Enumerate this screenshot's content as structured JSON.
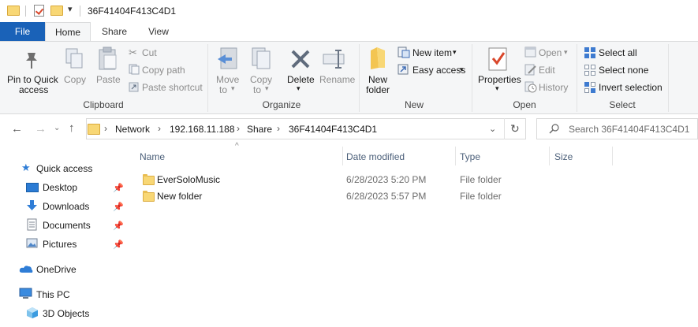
{
  "window": {
    "title": "36F41404F413C4D1"
  },
  "tabs": [
    "File",
    "Home",
    "Share",
    "View"
  ],
  "ribbon": {
    "clipboard": {
      "label": "Clipboard",
      "pin_line1": "Pin to Quick",
      "pin_line2": "access",
      "copy": "Copy",
      "paste": "Paste",
      "cut": "Cut",
      "copy_path": "Copy path",
      "paste_shortcut": "Paste shortcut"
    },
    "organize": {
      "label": "Organize",
      "move_to": "Move",
      "move_to_2": "to",
      "copy_to": "Copy",
      "copy_to_2": "to",
      "delete": "Delete",
      "rename": "Rename"
    },
    "new": {
      "label": "New",
      "new_folder_1": "New",
      "new_folder_2": "folder",
      "new_item": "New item",
      "easy_access": "Easy access"
    },
    "open": {
      "label": "Open",
      "properties": "Properties",
      "open": "Open",
      "edit": "Edit",
      "history": "History"
    },
    "select": {
      "label": "Select",
      "select_all": "Select all",
      "select_none": "Select none",
      "invert": "Invert selection"
    }
  },
  "address": {
    "crumbs": [
      "Network",
      "192.168.11.188",
      "Share",
      "36F41404F413C4D1"
    ],
    "search_placeholder": "Search 36F41404F413C4D1"
  },
  "columns": {
    "name": "Name",
    "date": "Date modified",
    "type": "Type",
    "size": "Size"
  },
  "files": [
    {
      "name": "EverSoloMusic",
      "date": "6/28/2023 5:20 PM",
      "type": "File folder",
      "size": ""
    },
    {
      "name": "New folder",
      "date": "6/28/2023 5:57 PM",
      "type": "File folder",
      "size": ""
    }
  ],
  "nav": {
    "quick_access": "Quick access",
    "desktop": "Desktop",
    "downloads": "Downloads",
    "documents": "Documents",
    "pictures": "Pictures",
    "onedrive": "OneDrive",
    "this_pc": "This PC",
    "objects3d": "3D Objects"
  }
}
